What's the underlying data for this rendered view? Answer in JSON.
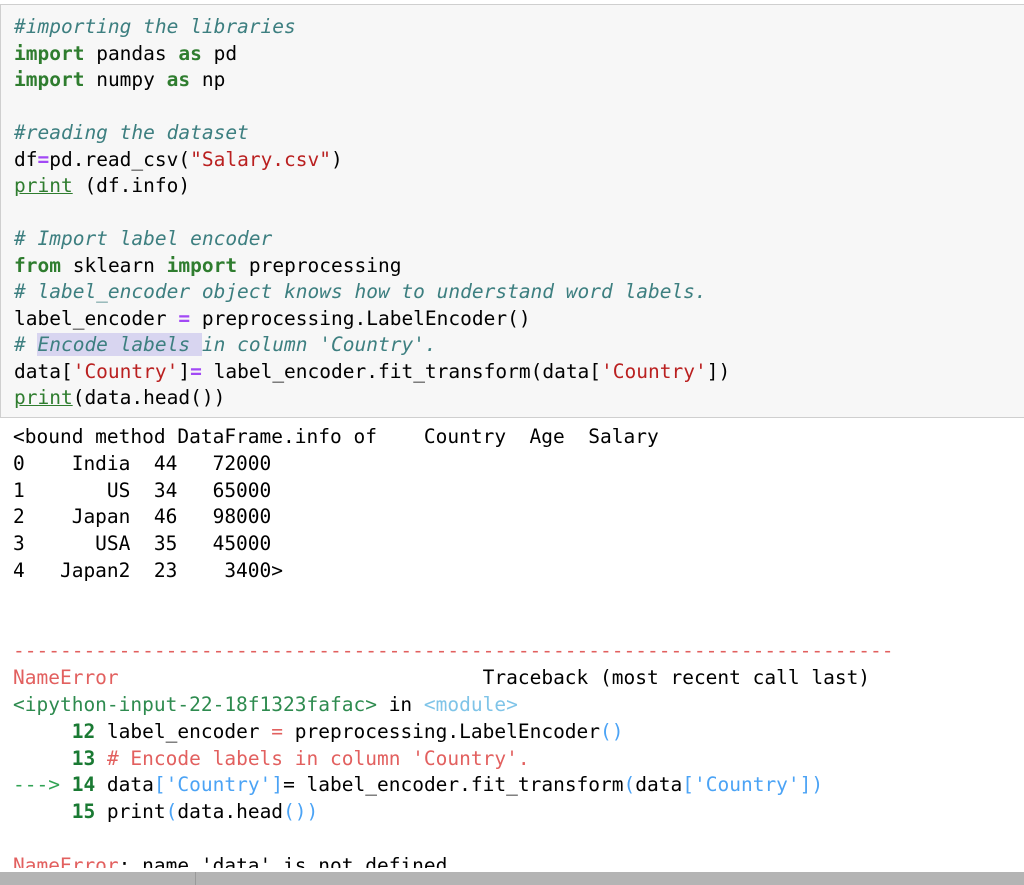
{
  "notebook": {
    "code_cell": {
      "lines": [
        {
          "id": "l1",
          "type": "comment",
          "text": "#importing the libraries"
        },
        {
          "id": "l2",
          "type": "code",
          "text": "import pandas as pd"
        },
        {
          "id": "l3",
          "type": "code",
          "text": "import numpy as np"
        },
        {
          "id": "l4",
          "type": "blank",
          "text": ""
        },
        {
          "id": "l5",
          "type": "comment",
          "text": "#reading the dataset"
        },
        {
          "id": "l6",
          "type": "code",
          "text": "df=pd.read_csv(\"Salary.csv\")"
        },
        {
          "id": "l7",
          "type": "code",
          "text": "print (df.info)"
        },
        {
          "id": "l8",
          "type": "blank",
          "text": ""
        },
        {
          "id": "l9",
          "type": "comment",
          "text": "# Import label encoder"
        },
        {
          "id": "l10",
          "type": "code",
          "text": "from sklearn import preprocessing"
        },
        {
          "id": "l11",
          "type": "comment",
          "text": "# label_encoder object knows how to understand word labels."
        },
        {
          "id": "l12",
          "type": "code",
          "text": "label_encoder = preprocessing.LabelEncoder()"
        },
        {
          "id": "l13",
          "type": "comment",
          "text": "# Encode labels in column 'Country'."
        },
        {
          "id": "l14",
          "type": "code",
          "text": "data['Country']= label_encoder.fit_transform(data['Country'])"
        },
        {
          "id": "l15",
          "type": "code",
          "text": "print(data.head())"
        }
      ],
      "tokens": {
        "import": "import",
        "from": "from",
        "as": "as",
        "print": "print",
        "pandas": "pandas",
        "pd": "pd",
        "numpy": "numpy",
        "np": "np",
        "sklearn": "sklearn",
        "preprocessing": "preprocessing",
        "csv_filename": "\"Salary.csv\"",
        "country_literal": "'Country'",
        "equals": "=",
        "assign": "="
      },
      "selection_highlight": "Encode labels"
    },
    "output": {
      "dataframe_header": "<bound method DataFrame.info of    Country  Age  Salary",
      "dataframe_rows": [
        {
          "index": "0",
          "country": "India",
          "age": "44",
          "salary": "72000",
          "raw": "0    India  44   72000"
        },
        {
          "index": "1",
          "country": "US",
          "age": "34",
          "salary": "65000",
          "raw": "1       US  34   65000"
        },
        {
          "index": "2",
          "country": "Japan",
          "age": "46",
          "salary": "98000",
          "raw": "2    Japan  46   98000"
        },
        {
          "index": "3",
          "country": "USA",
          "age": "35",
          "salary": "45000",
          "raw": "3      USA  35   45000"
        },
        {
          "index": "4",
          "country": "Japan2",
          "age": "23",
          "salary": "3400>",
          "raw": "4   Japan2  23    3400>"
        }
      ],
      "separator": "---------------------------------------------------------------------------",
      "error_name": "NameError",
      "traceback_label": "Traceback (most recent call last)",
      "input_ref": "<ipython-input-22-18f1323fafac>",
      "input_in": " in ",
      "module_ref": "<module>",
      "frames": [
        {
          "lineno": "12",
          "code": "label_encoder = preprocessing.LabelEncoder()",
          "arrow": ""
        },
        {
          "lineno": "13",
          "code": "# Encode labels in column 'Country'.",
          "arrow": ""
        },
        {
          "lineno": "14",
          "code": "data['Country']= label_encoder.fit_transform(data['Country'])",
          "arrow": "---> "
        },
        {
          "lineno": "15",
          "code": "print(data.head())",
          "arrow": ""
        }
      ],
      "error_final_name": "NameError",
      "error_final_message": ": name 'data' is not defined"
    }
  },
  "colors": {
    "keyword_green": "#2f7d2f",
    "comment_teal": "#3d7f80",
    "string_red": "#ba2020",
    "operator_purple": "#a249f5",
    "error_red": "#e2605f",
    "traceback_green": "#31a354",
    "traceback_blue": "#4ba3f5",
    "module_cyan": "#7fc4e8",
    "selection_lavender": "#d8d5f0",
    "cell_background": "#f7f7f7",
    "cell_border": "#cfcfcf",
    "scrollbar_gray": "#b4b4b4"
  }
}
